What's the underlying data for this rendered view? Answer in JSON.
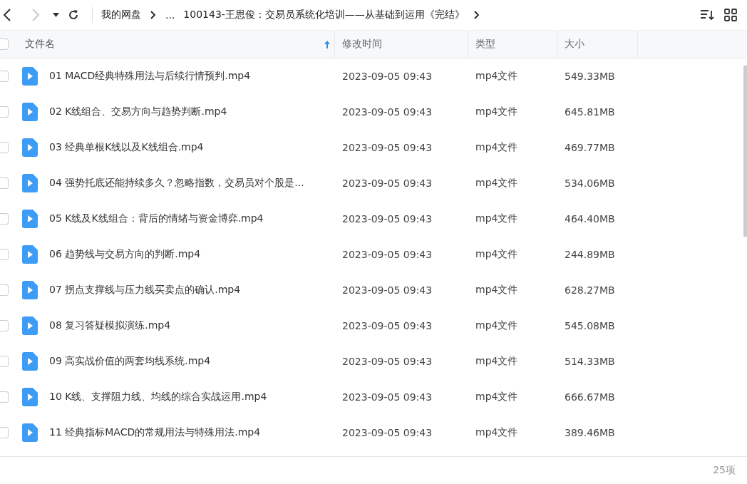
{
  "toolbar": {
    "back_disabled": false,
    "forward_disabled": true,
    "breadcrumb": [
      {
        "label": "我的网盘",
        "chevron": true
      },
      {
        "label": "...",
        "chevron": false
      },
      {
        "label": "100143-王思俊：交易员系统化培训——从基础到运用《完结》",
        "chevron": true
      }
    ]
  },
  "table": {
    "select_all": {
      "checked": false
    },
    "columns": [
      {
        "label": "文件名",
        "sorted": true
      },
      {
        "label": "修改时间",
        "sorted": false
      },
      {
        "label": "类型",
        "sorted": false
      },
      {
        "label": "大小",
        "sorted": false
      }
    ],
    "rows": [
      {
        "checked": false,
        "name": "01 MACD经典特殊用法与后续行情预判.mp4",
        "time": "2023-09-05 09:43",
        "type": "mp4文件",
        "size": "549.33MB"
      },
      {
        "checked": false,
        "name": "02 K线组合、交易方向与趋势判断.mp4",
        "time": "2023-09-05 09:43",
        "type": "mp4文件",
        "size": "645.81MB"
      },
      {
        "checked": false,
        "name": "03 经典单根K线以及K线组合.mp4",
        "time": "2023-09-05 09:43",
        "type": "mp4文件",
        "size": "469.77MB"
      },
      {
        "checked": false,
        "name": "04 强势托底还能持续多久？忽略指数，交易员对个股是...",
        "time": "2023-09-05 09:43",
        "type": "mp4文件",
        "size": "534.06MB"
      },
      {
        "checked": false,
        "name": "05 K线及K线组合：背后的情绪与资金博弈.mp4",
        "time": "2023-09-05 09:43",
        "type": "mp4文件",
        "size": "464.40MB"
      },
      {
        "checked": false,
        "name": "06 趋势线与交易方向的判断.mp4",
        "time": "2023-09-05 09:43",
        "type": "mp4文件",
        "size": "244.89MB"
      },
      {
        "checked": false,
        "name": "07 拐点支撑线与压力线买卖点的确认.mp4",
        "time": "2023-09-05 09:43",
        "type": "mp4文件",
        "size": "628.27MB"
      },
      {
        "checked": false,
        "name": "08 复习答疑模拟演练.mp4",
        "time": "2023-09-05 09:43",
        "type": "mp4文件",
        "size": "545.08MB"
      },
      {
        "checked": false,
        "name": "09 高实战价值的两套均线系统.mp4",
        "time": "2023-09-05 09:43",
        "type": "mp4文件",
        "size": "514.33MB"
      },
      {
        "checked": false,
        "name": "10 K线、支撑阻力线、均线的综合实战运用.mp4",
        "time": "2023-09-05 09:43",
        "type": "mp4文件",
        "size": "666.67MB"
      },
      {
        "checked": false,
        "name": "11 经典指标MACD的常规用法与特殊用法.mp4",
        "time": "2023-09-05 09:43",
        "type": "mp4文件",
        "size": "389.46MB"
      }
    ]
  },
  "status_bar": {
    "count": "25项"
  }
}
